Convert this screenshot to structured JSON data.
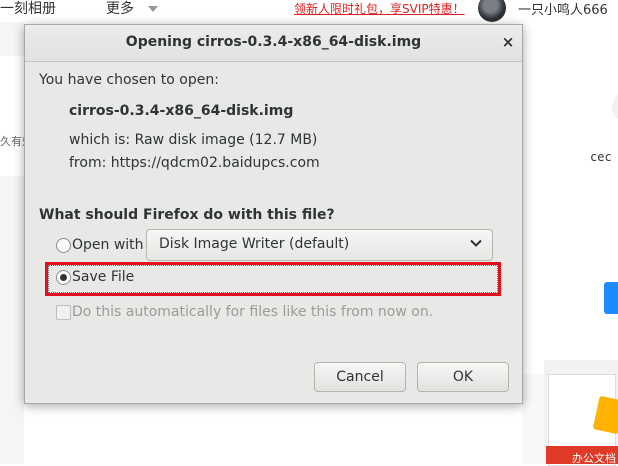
{
  "background": {
    "nav_left": "一刻相册",
    "nav_more": "更多",
    "promo": "领新人限时礼包，享SVIP特惠！",
    "username": "一只小鸣人666",
    "left_fragment": "久有效",
    "right_fragment": "cec",
    "ad_text": "办公文档"
  },
  "dialog": {
    "title": "Opening cirros-0.3.4-x86_64-disk.img",
    "close_symbol": "×",
    "chosen_label": "You have chosen to open:",
    "file_name": "cirros-0.3.4-x86_64-disk.img",
    "which_is": "which is: Raw disk image (12.7 MB)",
    "from": "from: https://qdcm02.baidupcs.com",
    "question": "What should Firefox do with this file?",
    "open_with_label": "Open with",
    "open_with_app": "Disk Image Writer (default)",
    "save_file_label": "Save File",
    "auto_label": "Do this automatically for files like this from now on.",
    "cancel_label": "Cancel",
    "ok_label": "OK",
    "selected_option": "save-file",
    "highlight_color": "#e0101e"
  }
}
